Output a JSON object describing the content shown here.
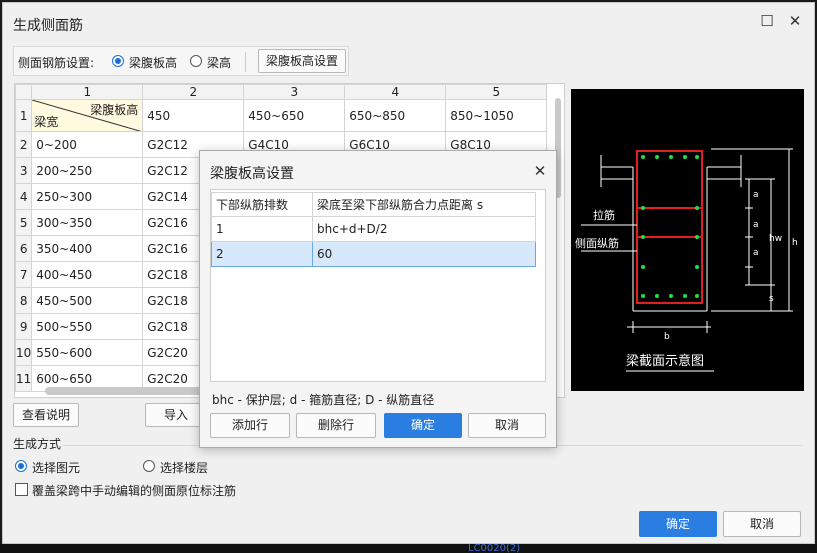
{
  "window": {
    "title": "生成侧面筋",
    "side_label": "侧面钢筋设置:",
    "radio_web_height": "梁腹板高",
    "radio_beam_height": "梁高",
    "web_height_setting_button": "梁腹板高设置",
    "view_help_button": "查看说明",
    "import_button": "导入",
    "gen_mode_label": "生成方式",
    "radio_select_element": "选择图元",
    "radio_select_floor": "选择楼层",
    "overwrite_label": "覆盖梁跨中手动编辑的侧面原位标注筋",
    "ok_button": "确定",
    "cancel_button": "取消"
  },
  "grid": {
    "col_headers": [
      "1",
      "2",
      "3",
      "4",
      "5"
    ],
    "corner_top": "梁腹板高",
    "corner_bottom": "梁宽",
    "row1": [
      "450",
      "450~650",
      "650~850",
      "850~1050"
    ],
    "rows": [
      {
        "num": "1"
      },
      {
        "num": "2",
        "c1": "0~200",
        "c2": "G2C12",
        "c3": "G4C10",
        "c4": "G6C10",
        "c5": "G8C10"
      },
      {
        "num": "3",
        "c1": "200~250",
        "c2": "G2C12"
      },
      {
        "num": "4",
        "c1": "250~300",
        "c2": "G2C14"
      },
      {
        "num": "5",
        "c1": "300~350",
        "c2": "G2C16"
      },
      {
        "num": "6",
        "c1": "350~400",
        "c2": "G2C16"
      },
      {
        "num": "7",
        "c1": "400~450",
        "c2": "G2C18"
      },
      {
        "num": "8",
        "c1": "450~500",
        "c2": "G2C18"
      },
      {
        "num": "9",
        "c1": "500~550",
        "c2": "G2C18"
      },
      {
        "num": "10",
        "c1": "550~600",
        "c2": "G2C20"
      },
      {
        "num": "11",
        "c1": "600~650",
        "c2": "G2C20"
      }
    ]
  },
  "preview": {
    "caption": "梁截面示意图",
    "tie_label": "拉筋",
    "side_label": "侧面纵筋",
    "dim_a": "a",
    "dim_hw": "hw",
    "dim_h": "h",
    "dim_s": "s",
    "dim_b": "b",
    "colors": {
      "rebar": "#e02020",
      "dots": "#20e040",
      "lines": "#ffffff"
    }
  },
  "dialog": {
    "title": "梁腹板高设置",
    "col1": "下部纵筋排数",
    "col2": "梁底至梁下部纵筋合力点距离 s",
    "rows": [
      {
        "n": "1",
        "s": "bhc+d+D/2"
      },
      {
        "n": "2",
        "s": "60"
      }
    ],
    "legend": "bhc - 保护层;  d - 箍筋直径;  D - 纵筋直径",
    "add_row": "添加行",
    "delete_row": "删除行",
    "ok": "确定",
    "cancel": "取消"
  },
  "background": {
    "bottom_text": "LC0020(2)"
  }
}
